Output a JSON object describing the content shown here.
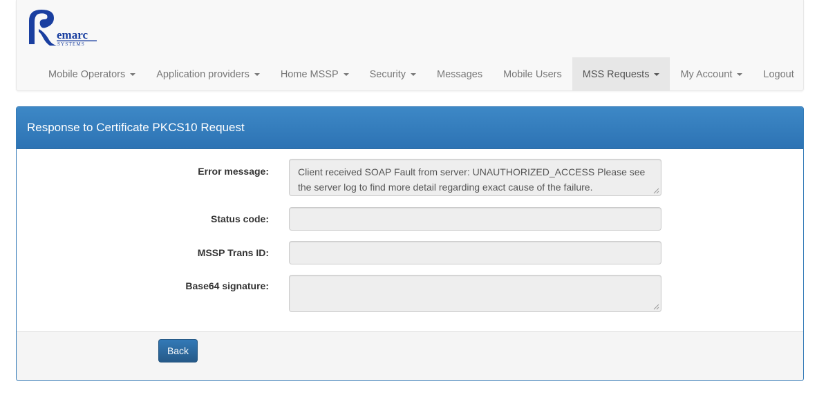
{
  "brand": {
    "logo_text": "emarc",
    "logo_subtext": "SYSTEMS",
    "logo_color": "#1a3fa0"
  },
  "nav": {
    "items": [
      {
        "label": "Mobile Operators",
        "dropdown": true
      },
      {
        "label": "Application providers",
        "dropdown": true
      },
      {
        "label": "Home MSSP",
        "dropdown": true
      },
      {
        "label": "Security",
        "dropdown": true
      },
      {
        "label": "Messages",
        "dropdown": false
      },
      {
        "label": "Mobile Users",
        "dropdown": false
      },
      {
        "label": "MSS Requests",
        "dropdown": true,
        "active": true
      },
      {
        "label": "My Account",
        "dropdown": true
      },
      {
        "label": "Logout",
        "dropdown": false
      }
    ]
  },
  "panel": {
    "title": "Response to Certificate PKCS10 Request",
    "fields": {
      "error_message": {
        "label": "Error message:",
        "value": "Client received SOAP Fault from server: UNAUTHORIZED_ACCESS Please see the server log to find more detail regarding exact cause of the failure."
      },
      "status_code": {
        "label": "Status code:",
        "value": ""
      },
      "mssp_trans_id": {
        "label": "MSSP Trans ID:",
        "value": ""
      },
      "base64_signature": {
        "label": "Base64 signature:",
        "value": ""
      }
    },
    "back_label": "Back"
  },
  "colors": {
    "primary": "#337ab7",
    "panel_heading": "#3380c0",
    "field_bg": "#eeeeee"
  }
}
